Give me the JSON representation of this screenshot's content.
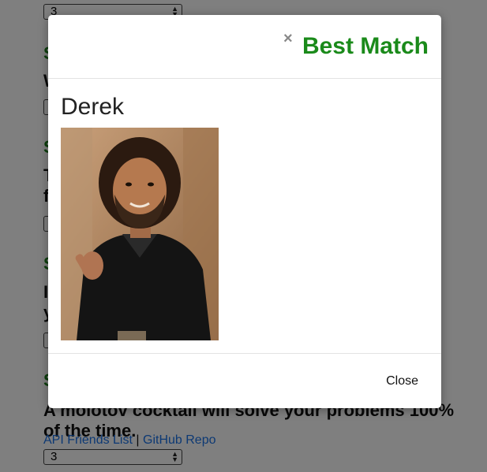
{
  "background": {
    "survey_selects": [
      "3",
      "",
      "",
      "",
      "3"
    ],
    "questions": [
      {
        "heading": "S",
        "text": "W"
      },
      {
        "heading": "S",
        "text": "T\nf"
      },
      {
        "heading": "S",
        "text": "I\ny"
      },
      {
        "heading": "S",
        "text": "A molotov cocktail will solve your problems 100% of the time."
      }
    ],
    "footer": {
      "link1": "API Friends List",
      "separator": "|",
      "link2": "GitHub Repo"
    }
  },
  "modal": {
    "close_icon": "×",
    "title": "Best Match",
    "friend_name": "Derek",
    "photo_icon": "person-photo",
    "close_button": "Close",
    "colors": {
      "title": "#1a8a1a",
      "heading": "#1a7f1a",
      "link": "#1a73e8"
    }
  }
}
